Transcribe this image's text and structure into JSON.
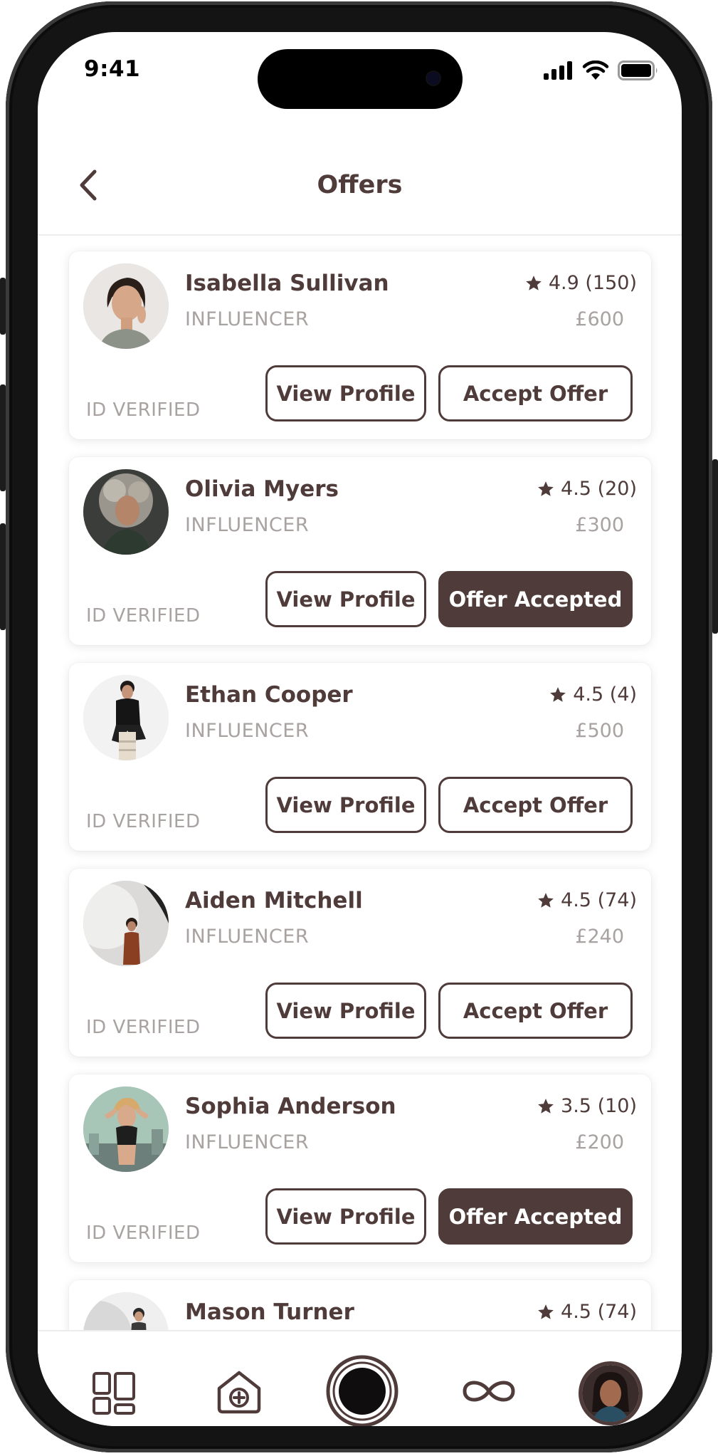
{
  "status_bar": {
    "time": "9:41"
  },
  "header": {
    "title": "Offers"
  },
  "offers": [
    {
      "name": "Isabella Sullivan",
      "role": "INFLUENCER",
      "rating": "4.9 (150)",
      "price": "£600",
      "verified": "ID VERIFIED",
      "view_label": "View Profile",
      "action_label": "Accept Offer",
      "accepted": false
    },
    {
      "name": "Olivia Myers",
      "role": "INFLUENCER",
      "rating": "4.5 (20)",
      "price": "£300",
      "verified": "ID VERIFIED",
      "view_label": "View Profile",
      "action_label": "Offer Accepted",
      "accepted": true
    },
    {
      "name": "Ethan Cooper",
      "role": "INFLUENCER",
      "rating": "4.5 (4)",
      "price": "£500",
      "verified": "ID VERIFIED",
      "view_label": "View Profile",
      "action_label": "Accept Offer",
      "accepted": false
    },
    {
      "name": "Aiden Mitchell",
      "role": "INFLUENCER",
      "rating": "4.5 (74)",
      "price": "£240",
      "verified": "ID VERIFIED",
      "view_label": "View Profile",
      "action_label": "Accept Offer",
      "accepted": false
    },
    {
      "name": "Sophia Anderson",
      "role": "INFLUENCER",
      "rating": "3.5 (10)",
      "price": "£200",
      "verified": "ID VERIFIED",
      "view_label": "View Profile",
      "action_label": "Offer Accepted",
      "accepted": true
    },
    {
      "name": "Mason Turner",
      "rating": "4.5 (74)"
    }
  ],
  "tabbar": {
    "items": [
      "dashboard-icon",
      "home-add-icon",
      "record-icon",
      "infinity-icon",
      "profile-avatar"
    ]
  },
  "colors": {
    "primary": "#4f3c3a",
    "muted": "#a8a2a1",
    "background": "#ffffff"
  }
}
